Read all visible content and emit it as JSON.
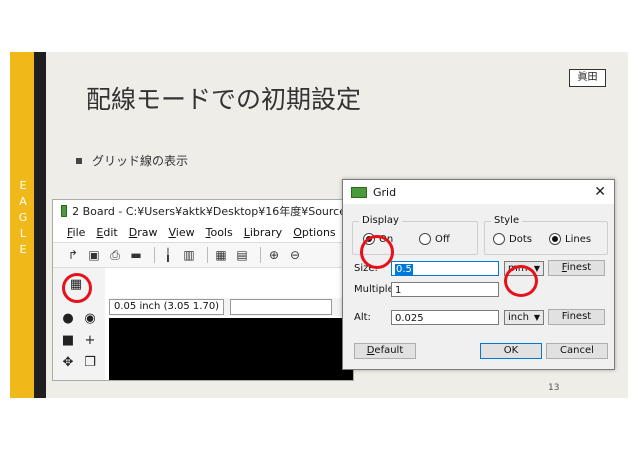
{
  "slide": {
    "side_label": "EAGLE",
    "title": "配線モードでの初期設定",
    "author": "眞田",
    "bullet": "グリッド線の表示",
    "page_number": "13",
    "accent_color": "#f0b818"
  },
  "eagle_window": {
    "title": "2 Board - C:¥Users¥aktk¥Desktop¥16年度¥Source¥",
    "menu": [
      "File",
      "Edit",
      "Draw",
      "View",
      "Tools",
      "Library",
      "Options"
    ],
    "coordinate": "0.05 inch (3.05 1.70)",
    "toolbar_icons": [
      "open-icon",
      "save-icon",
      "print-icon",
      "cam-icon",
      "script-icon",
      "run-icon",
      "drc-icon",
      "erc-icon",
      "zoom-in-icon",
      "zoom-out-icon"
    ],
    "grid_icon": "grid-icon"
  },
  "grid_dialog": {
    "title": "Grid",
    "display_label": "Display",
    "display_on": "On",
    "display_off": "Off",
    "style_label": "Style",
    "style_dots": "Dots",
    "style_lines": "Lines",
    "size_label": "Size:",
    "size_value": "0.5",
    "size_unit": "mm",
    "finest_label": "Finest",
    "multiple_label": "Multiple:",
    "multiple_value": "1",
    "alt_label": "Alt:",
    "alt_value": "0.025",
    "alt_unit": "inch",
    "alt_finest_label": "Finest",
    "default_label": "Default",
    "ok_label": "OK",
    "cancel_label": "Cancel",
    "annotation_color": "#e5121a"
  }
}
